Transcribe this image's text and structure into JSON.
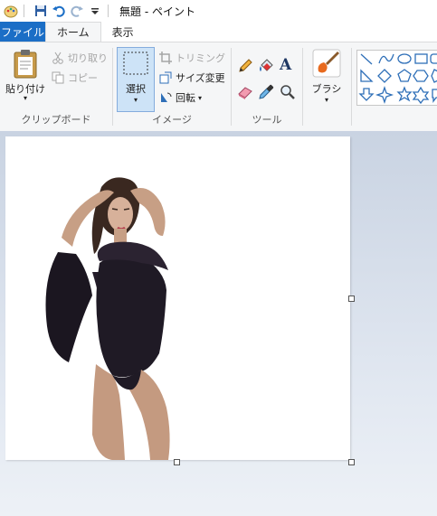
{
  "window": {
    "title": "無題 - ペイント"
  },
  "tabs": {
    "file": "ファイル",
    "home": "ホーム",
    "view": "表示"
  },
  "ribbon": {
    "clipboard": {
      "paste": "貼り付け",
      "cut": "切り取り",
      "copy": "コピー",
      "label": "クリップボード"
    },
    "image": {
      "select": "選択",
      "crop": "トリミング",
      "resize": "サイズ変更",
      "rotate": "回転",
      "label": "イメージ"
    },
    "tools": {
      "label": "ツール"
    },
    "brushes": {
      "label": "ブラシ"
    }
  },
  "colors": {
    "accent": "#1b6ec6",
    "ribbon_bg": "#f5f6f7",
    "canvas_bg": "#d6deea",
    "selection_bg": "#cde3f7",
    "shape_stroke": "#2e6fb8"
  }
}
